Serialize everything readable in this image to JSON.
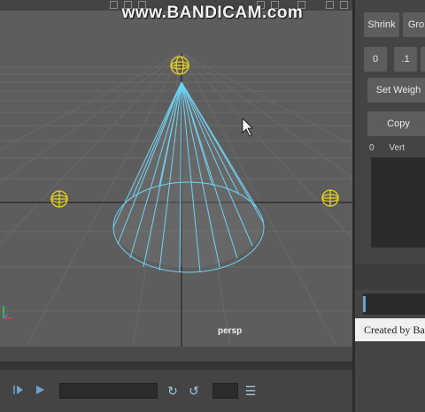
{
  "watermark": "www.BANDICAM.com",
  "viewport": {
    "camera_label": "persp"
  },
  "panel": {
    "shrink_label": "Shrink",
    "grow_label": "Gro",
    "value_buttons": [
      "0",
      ".1",
      ""
    ],
    "set_weight_label": "Set Weigh",
    "copy_label": "Copy",
    "list_header": {
      "index": "0",
      "column": "Vert"
    },
    "credit": "Created by Bai"
  },
  "colors": {
    "wireframe": "#6fd3f5",
    "locator": "#e6d21e",
    "grid": "#6c6c6c",
    "timeline_accent": "#6aa3cf"
  },
  "icons": [
    "play-forward-icon",
    "play-icon",
    "key-prev-icon",
    "key-next-icon",
    "list-settings-icon",
    "mouse-cursor-icon",
    "axis-gizmo-icon"
  ]
}
